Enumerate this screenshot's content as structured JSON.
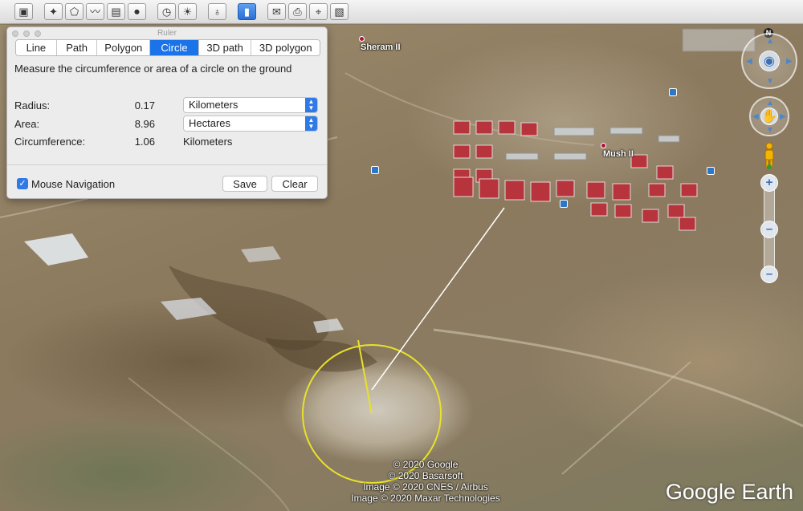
{
  "toolbar": {
    "buttons": [
      {
        "name": "sidebar-toggle-icon",
        "glyph": "▣",
        "active": false
      },
      {
        "name": "placemark-icon",
        "glyph": "✦",
        "active": false
      },
      {
        "name": "polygon-icon",
        "glyph": "⬠",
        "active": false
      },
      {
        "name": "path-icon",
        "glyph": "〰",
        "active": false
      },
      {
        "name": "image-overlay-icon",
        "glyph": "▤",
        "active": false
      },
      {
        "name": "record-tour-icon",
        "glyph": "⏺",
        "active": false
      },
      {
        "name": "historical-imagery-icon",
        "glyph": "◷",
        "active": false
      },
      {
        "name": "sunlight-icon",
        "glyph": "☀",
        "active": false
      },
      {
        "name": "planets-icon",
        "glyph": "♁",
        "active": false
      },
      {
        "name": "ruler-icon",
        "glyph": "▮",
        "active": true
      },
      {
        "name": "email-icon",
        "glyph": "✉",
        "active": false
      },
      {
        "name": "print-icon",
        "glyph": "⎙",
        "active": false
      },
      {
        "name": "view-in-maps-icon",
        "glyph": "⌖",
        "active": false
      },
      {
        "name": "save-image-icon",
        "glyph": "▧",
        "active": false
      }
    ]
  },
  "ruler": {
    "window_title": "Ruler",
    "tabs": [
      {
        "label": "Line",
        "active": false
      },
      {
        "label": "Path",
        "active": false
      },
      {
        "label": "Polygon",
        "active": false
      },
      {
        "label": "Circle",
        "active": true
      },
      {
        "label": "3D path",
        "active": false
      },
      {
        "label": "3D polygon",
        "active": false
      }
    ],
    "description": "Measure the circumference or area of a circle on the ground",
    "radius": {
      "label": "Radius:",
      "value": "0.17",
      "unit": "Kilometers"
    },
    "area": {
      "label": "Area:",
      "value": "8.96",
      "unit": "Hectares"
    },
    "circumference": {
      "label": "Circumference:",
      "value": "1.06",
      "unit": "Kilometers"
    },
    "mouse_navigation": {
      "label": "Mouse Navigation",
      "checked": true
    },
    "save_label": "Save",
    "clear_label": "Clear"
  },
  "map": {
    "places": [
      {
        "name": "Sheram II"
      },
      {
        "name": "Mush II"
      }
    ],
    "copyright": [
      "© 2020 Google",
      "© 2020 Basarsoft",
      "Image © 2020 CNES / Airbus",
      "Image © 2020 Maxar Technologies"
    ],
    "brand": "Google Earth",
    "north_label": "N",
    "measure_circle_color": "#e8e22a",
    "building_color": "#b8343c"
  }
}
